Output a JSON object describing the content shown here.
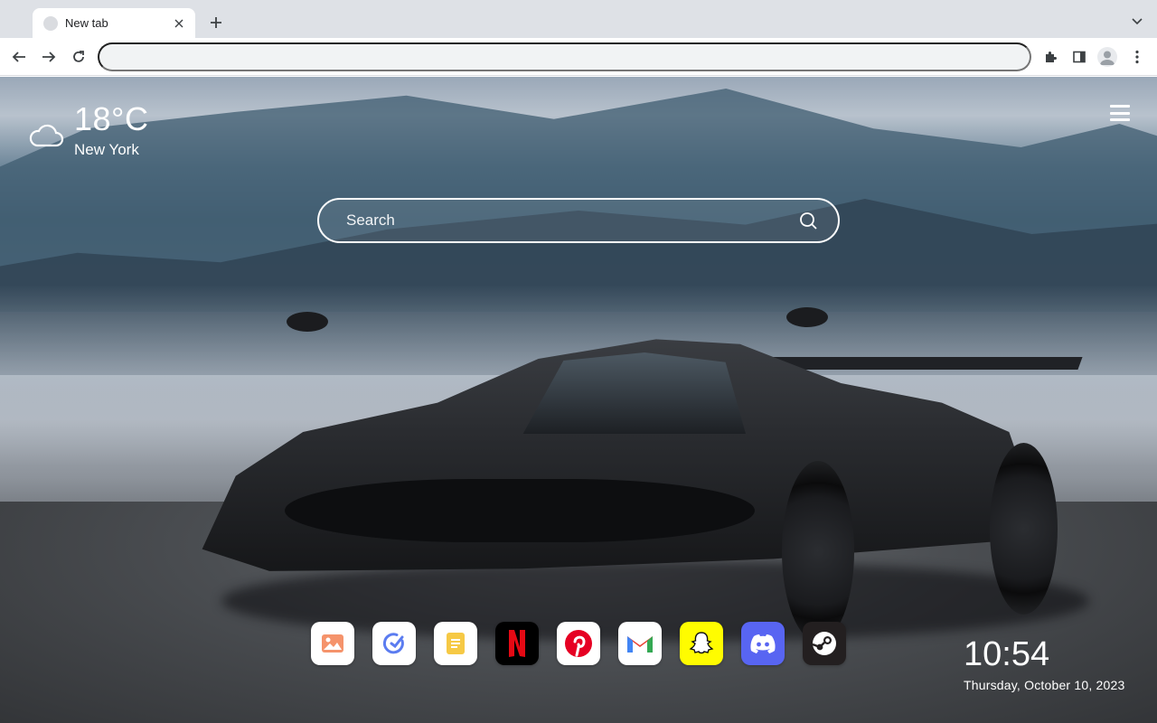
{
  "browser": {
    "tab": {
      "title": "New tab"
    },
    "omnibox": {
      "value": "",
      "placeholder": ""
    }
  },
  "weather": {
    "temperature": "18°C",
    "city": "New York",
    "icon": "cloud-icon"
  },
  "search": {
    "placeholder": "Search",
    "icon": "search-icon"
  },
  "shortcuts": [
    {
      "name": "Photos",
      "icon": "image-icon",
      "bg": "#ffffff",
      "fg": "#f07f4e"
    },
    {
      "name": "Tasks",
      "icon": "check-circle-icon",
      "bg": "#ffffff",
      "fg": "#5b7cf0"
    },
    {
      "name": "Notes",
      "icon": "note-icon",
      "bg": "#ffffff",
      "fg": "#f4c542"
    },
    {
      "name": "Netflix",
      "icon": "netflix-icon",
      "bg": "#000000",
      "fg": "#e50914"
    },
    {
      "name": "Pinterest",
      "icon": "pinterest-icon",
      "bg": "#ffffff",
      "fg": "#e60023"
    },
    {
      "name": "Gmail",
      "icon": "gmail-icon",
      "bg": "#ffffff",
      "fg": "#ea4335"
    },
    {
      "name": "Snapchat",
      "icon": "snapchat-icon",
      "bg": "#fffc00",
      "fg": "#ffffff"
    },
    {
      "name": "Discord",
      "icon": "discord-icon",
      "bg": "#5865f2",
      "fg": "#ffffff"
    },
    {
      "name": "Steam",
      "icon": "steam-icon",
      "bg": "#231f20",
      "fg": "#ffffff"
    }
  ],
  "clock": {
    "time": "10:54",
    "date": "Thursday, October 10, 2023"
  },
  "colors": {
    "tabstrip": "#dee1e6",
    "omnibox_bg": "#f1f3f4"
  }
}
